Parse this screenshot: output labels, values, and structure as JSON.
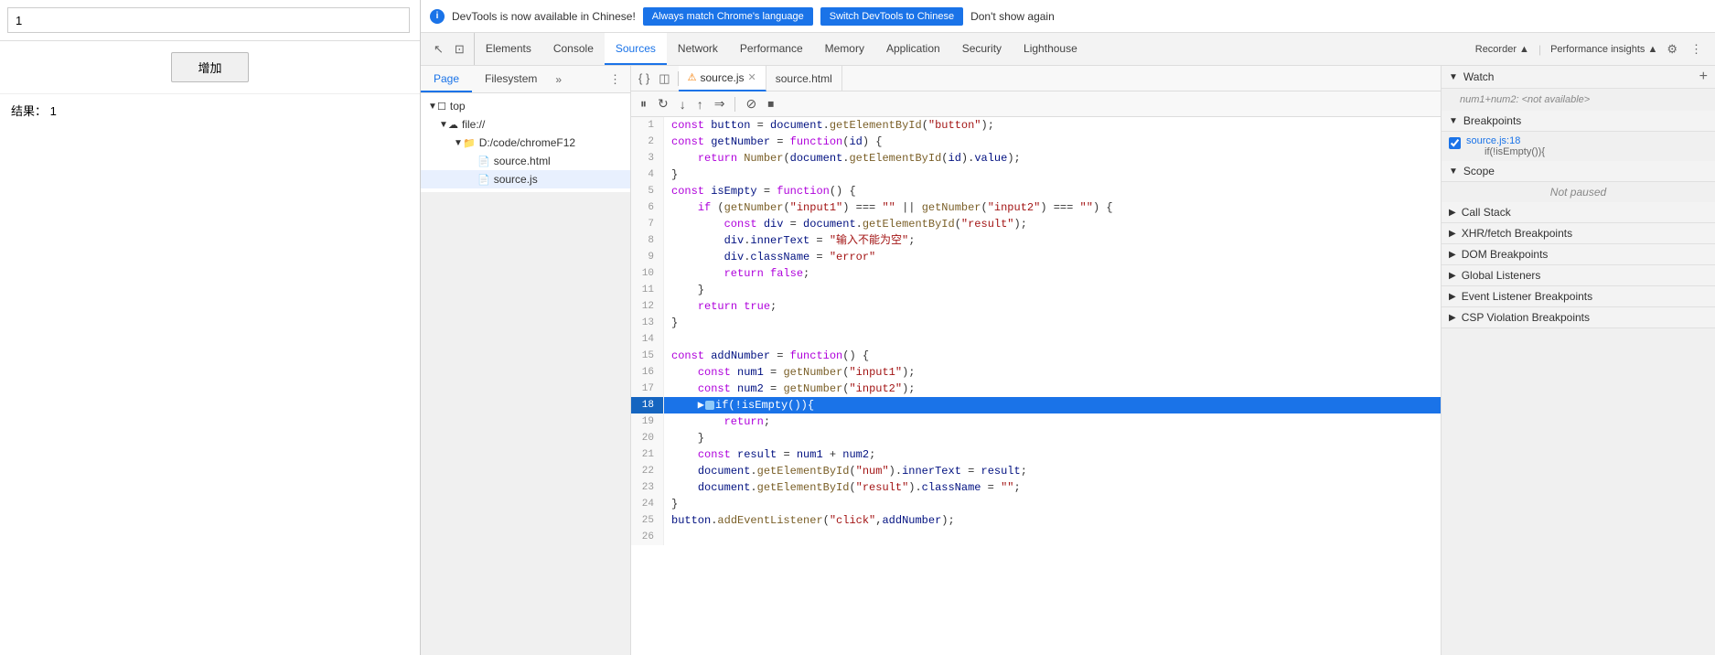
{
  "left": {
    "input_value": "1",
    "button_label": "增加",
    "result_label": "结果：",
    "result_value": "1"
  },
  "infobar": {
    "icon": "i",
    "message": "DevTools is now available in Chinese!",
    "btn1": "Always match Chrome's language",
    "btn2": "Switch DevTools to Chinese",
    "btn3": "Don't show again"
  },
  "tabs": [
    {
      "id": "elements",
      "label": "Elements"
    },
    {
      "id": "console",
      "label": "Console"
    },
    {
      "id": "sources",
      "label": "Sources",
      "active": true
    },
    {
      "id": "network",
      "label": "Network"
    },
    {
      "id": "performance",
      "label": "Performance"
    },
    {
      "id": "memory",
      "label": "Memory"
    },
    {
      "id": "application",
      "label": "Application"
    },
    {
      "id": "security",
      "label": "Security"
    },
    {
      "id": "lighthouse",
      "label": "Lighthouse"
    },
    {
      "id": "recorder",
      "label": "Recorder"
    },
    {
      "id": "performance_insights",
      "label": "Performance insights"
    }
  ],
  "sub_tabs": [
    {
      "id": "page",
      "label": "Page",
      "active": true
    },
    {
      "id": "filesystem",
      "label": "Filesystem"
    }
  ],
  "file_tree": {
    "root": "top",
    "items": [
      {
        "id": "top",
        "label": "top",
        "type": "root",
        "indent": 0
      },
      {
        "id": "file",
        "label": "file://",
        "type": "cloud",
        "indent": 1
      },
      {
        "id": "chromeF12",
        "label": "D:/code/chromeF12",
        "type": "folder",
        "indent": 2
      },
      {
        "id": "source_html",
        "label": "source.html",
        "type": "file",
        "indent": 3
      },
      {
        "id": "source_js",
        "label": "source.js",
        "type": "file-js",
        "indent": 3,
        "selected": true
      }
    ]
  },
  "source_tabs": [
    {
      "id": "source_js",
      "label": "source.js",
      "active": true,
      "warn": true,
      "closeable": true
    },
    {
      "id": "source_html",
      "label": "source.html",
      "active": false,
      "warn": false,
      "closeable": true
    }
  ],
  "code": {
    "lines": [
      {
        "num": 1,
        "content": "const button = document.getElementById(\"button\");"
      },
      {
        "num": 2,
        "content": "const getNumber = function(id) {"
      },
      {
        "num": 3,
        "content": "    return Number(document.getElementById(id).value);"
      },
      {
        "num": 4,
        "content": "}"
      },
      {
        "num": 5,
        "content": "const isEmpty = function() {"
      },
      {
        "num": 6,
        "content": "    if (getNumber(\"input1\") === \"\" || getNumber(\"input2\") === \"\") {"
      },
      {
        "num": 7,
        "content": "        const div = document.getElementById(\"result\");"
      },
      {
        "num": 8,
        "content": "        div.innerText = \"输入不能为空\";"
      },
      {
        "num": 9,
        "content": "        div.className = \"error\""
      },
      {
        "num": 10,
        "content": "        return false;"
      },
      {
        "num": 11,
        "content": "    }"
      },
      {
        "num": 12,
        "content": "    return true;"
      },
      {
        "num": 13,
        "content": "}"
      },
      {
        "num": 14,
        "content": ""
      },
      {
        "num": 15,
        "content": "const addNumber = function() {"
      },
      {
        "num": 16,
        "content": "    const num1 = getNumber(\"input1\");"
      },
      {
        "num": 17,
        "content": "    const num2 = getNumber(\"input2\");"
      },
      {
        "num": 18,
        "content": "    ▶if(□isEmpty()){",
        "highlighted": true,
        "breakpoint": true
      },
      {
        "num": 19,
        "content": "        return;"
      },
      {
        "num": 20,
        "content": "    }"
      },
      {
        "num": 21,
        "content": "    const result = num1 + num2;"
      },
      {
        "num": 22,
        "content": "    document.getElementById(\"num\").innerText = result;"
      },
      {
        "num": 23,
        "content": "    document.getElementById(\"result\").className = \"\";"
      },
      {
        "num": 24,
        "content": "}"
      },
      {
        "num": 25,
        "content": "button.addEventListener(\"click\",addNumber);"
      },
      {
        "num": 26,
        "content": ""
      }
    ]
  },
  "debugger": {
    "watch_title": "Watch",
    "watch_empty": "num1+num2: <not available>",
    "breakpoints_title": "Breakpoints",
    "breakpoint_file": "source.js:18",
    "breakpoint_code": "if(!isEmpty()){",
    "scope_title": "Scope",
    "scope_status": "Not paused",
    "callstack_title": "Call Stack",
    "xhr_title": "XHR/fetch Breakpoints",
    "dom_title": "DOM Breakpoints",
    "global_title": "Global Listeners",
    "event_title": "Event Listener Breakpoints",
    "csp_title": "CSP Violation Breakpoints"
  }
}
